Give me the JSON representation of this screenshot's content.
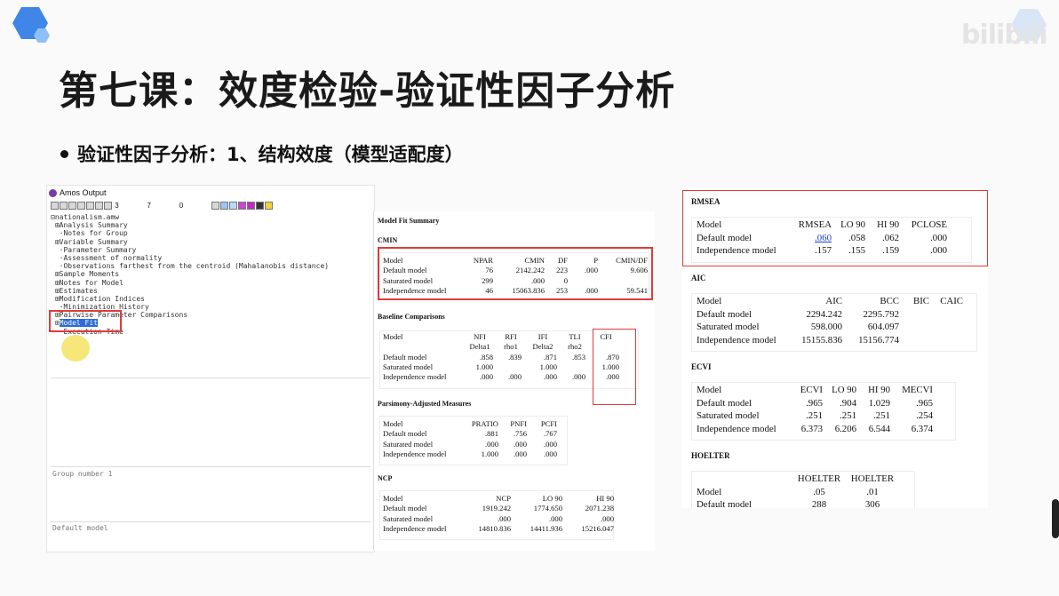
{
  "slide": {
    "title": "第七课：效度检验-验证性因子分析",
    "bullet": "验证性因子分析：1、结构效度（模型适配度）",
    "watermark": "bilibili"
  },
  "amos": {
    "window_title": "Amos Output",
    "toolbar": {
      "field1": "3",
      "field2": "7",
      "field3": "0"
    },
    "tree": [
      "nationalism.amw",
      "Analysis Summary",
      "Notes for Group",
      "Variable Summary",
      "Parameter Summary",
      "Assessment of normality",
      "Observations farthest from the centroid (Mahalanobis distance)",
      "Sample Moments",
      "Notes for Model",
      "Estimates",
      "Modification Indices",
      "Minimization History",
      "Pairwise Parameter Comparisons",
      "Model Fit",
      "Execution Time"
    ],
    "group_label": "Group number 1",
    "model_label": "Default model"
  },
  "fit": {
    "summary_title": "Model Fit Summary",
    "cmin": {
      "title": "CMIN",
      "headers": [
        "Model",
        "NPAR",
        "CMIN",
        "DF",
        "P",
        "CMIN/DF"
      ],
      "rows": [
        [
          "Default model",
          "76",
          "2142.242",
          "223",
          ".000",
          "9.606"
        ],
        [
          "Saturated model",
          "299",
          ".000",
          "0",
          "",
          ""
        ],
        [
          "Independence model",
          "46",
          "15063.836",
          "253",
          ".000",
          "59.541"
        ]
      ]
    },
    "baseline": {
      "title": "Baseline Comparisons",
      "h1": [
        "Model",
        "NFI",
        "RFI",
        "IFI",
        "TLI",
        "CFI"
      ],
      "h2": [
        "",
        "Delta1",
        "rho1",
        "Delta2",
        "rho2",
        ""
      ],
      "rows": [
        [
          "Default model",
          ".858",
          ".839",
          ".871",
          ".853",
          ".870"
        ],
        [
          "Saturated model",
          "1.000",
          "",
          "1.000",
          "",
          "1.000"
        ],
        [
          "Independence model",
          ".000",
          ".000",
          ".000",
          ".000",
          ".000"
        ]
      ]
    },
    "parsimony": {
      "title": "Parsimony-Adjusted Measures",
      "headers": [
        "Model",
        "PRATIO",
        "PNFI",
        "PCFI"
      ],
      "rows": [
        [
          "Default model",
          ".881",
          ".756",
          ".767"
        ],
        [
          "Saturated model",
          ".000",
          ".000",
          ".000"
        ],
        [
          "Independence model",
          "1.000",
          ".000",
          ".000"
        ]
      ]
    },
    "ncp": {
      "title": "NCP",
      "headers": [
        "Model",
        "NCP",
        "LO 90",
        "HI 90"
      ],
      "rows": [
        [
          "Default model",
          "1919.242",
          "1774.650",
          "2071.238"
        ],
        [
          "Saturated model",
          ".000",
          ".000",
          ".000"
        ],
        [
          "Independence model",
          "14810.836",
          "14411.936",
          "15216.047"
        ]
      ]
    }
  },
  "right": {
    "rmsea": {
      "title": "RMSEA",
      "headers": [
        "Model",
        "RMSEA",
        "LO 90",
        "HI 90",
        "PCLOSE"
      ],
      "rows": [
        [
          "Default model",
          ".060",
          ".058",
          ".062",
          ".000"
        ],
        [
          "Independence model",
          ".157",
          ".155",
          ".159",
          ".000"
        ]
      ]
    },
    "aic": {
      "title": "AIC",
      "headers": [
        "Model",
        "AIC",
        "BCC",
        "BIC",
        "CAIC"
      ],
      "rows": [
        [
          "Default model",
          "2294.242",
          "2295.792",
          "",
          ""
        ],
        [
          "Saturated model",
          "598.000",
          "604.097",
          "",
          ""
        ],
        [
          "Independence model",
          "15155.836",
          "15156.774",
          "",
          ""
        ]
      ]
    },
    "ecvi": {
      "title": "ECVI",
      "headers": [
        "Model",
        "ECVI",
        "LO 90",
        "HI 90",
        "MECVI"
      ],
      "rows": [
        [
          "Default model",
          ".965",
          ".904",
          "1.029",
          ".965"
        ],
        [
          "Saturated model",
          ".251",
          ".251",
          ".251",
          ".254"
        ],
        [
          "Independence model",
          "6.373",
          "6.206",
          "6.544",
          "6.374"
        ]
      ]
    },
    "hoelter": {
      "title": "HOELTER",
      "h1": [
        "Model",
        "HOELTER",
        "HOELTER"
      ],
      "h2": [
        "",
        ".05",
        ".01"
      ],
      "rows": [
        [
          "Default model",
          "288",
          "306"
        ]
      ]
    }
  },
  "colors": {
    "highlight": "#e03b3b",
    "selection": "#2c6bd8",
    "brand": "#3f86e8"
  }
}
